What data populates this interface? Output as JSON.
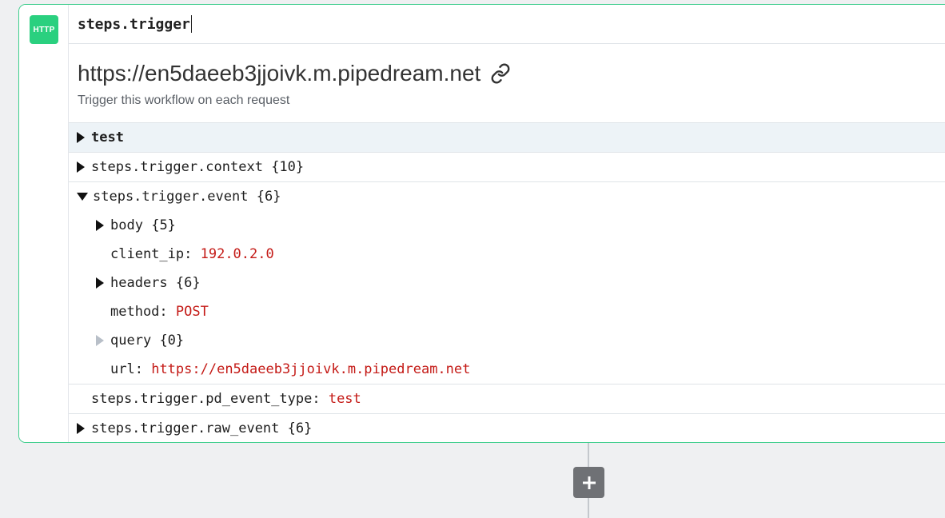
{
  "step": {
    "badge": "HTTP",
    "name": "steps.trigger",
    "url": "https://en5daeeb3jjoivk.m.pipedream.net",
    "description": "Trigger this workflow on each request",
    "link_icon": "link-icon"
  },
  "inspector": {
    "test_row": "test",
    "context": {
      "key": "steps.trigger.context",
      "count": "{10}"
    },
    "event": {
      "key": "steps.trigger.event",
      "count": "{6}"
    },
    "event_children": {
      "body": {
        "key": "body",
        "count": "{5}"
      },
      "client_ip": {
        "key": "client_ip:",
        "value": "192.0.2.0"
      },
      "headers": {
        "key": "headers",
        "count": "{6}"
      },
      "method": {
        "key": "method:",
        "value": "POST"
      },
      "query": {
        "key": "query",
        "count": "{0}"
      },
      "url": {
        "key": "url:",
        "value": "https://en5daeeb3jjoivk.m.pipedream.net"
      }
    },
    "pd_event_type": {
      "key": "steps.trigger.pd_event_type:",
      "value": "test"
    },
    "raw_event": {
      "key": "steps.trigger.raw_event",
      "count": "{6}"
    }
  },
  "add_step_icon": "plus-icon",
  "colors": {
    "accent": "#2ad07f",
    "border": "#3dcd8c",
    "value": "#c41a16"
  }
}
